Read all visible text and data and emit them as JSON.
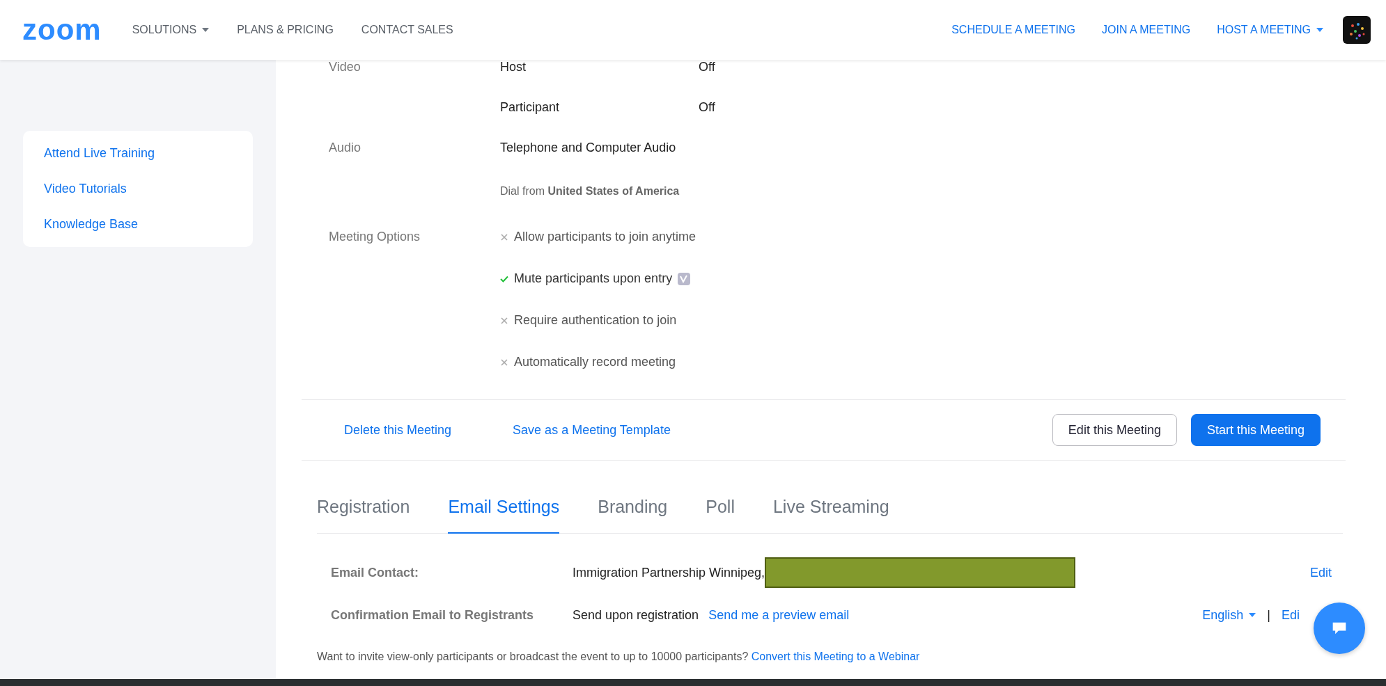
{
  "header": {
    "logo": "zoom",
    "nav_left": [
      {
        "label": "SOLUTIONS",
        "dropdown": true
      },
      {
        "label": "PLANS & PRICING",
        "dropdown": false
      },
      {
        "label": "CONTACT SALES",
        "dropdown": false
      }
    ],
    "nav_right": [
      {
        "label": "SCHEDULE A MEETING",
        "dropdown": false
      },
      {
        "label": "JOIN A MEETING",
        "dropdown": false
      },
      {
        "label": "HOST A MEETING",
        "dropdown": true
      }
    ]
  },
  "sidebar": {
    "links": [
      "Attend Live Training",
      "Video Tutorials",
      "Knowledge Base"
    ]
  },
  "details": {
    "video": {
      "label": "Video",
      "rows": [
        {
          "name": "Host",
          "value": "Off"
        },
        {
          "name": "Participant",
          "value": "Off"
        }
      ]
    },
    "audio": {
      "label": "Audio",
      "value": "Telephone and Computer Audio",
      "dial": "Dial from **United States of America**"
    },
    "meeting_options": {
      "label": "Meeting Options",
      "options": [
        {
          "text": "Allow participants to join anytime",
          "checked": false,
          "info_badge": false
        },
        {
          "text": "Mute participants upon entry",
          "checked": true,
          "info_badge": true
        },
        {
          "text": "Require authentication to join",
          "checked": false,
          "info_badge": false
        },
        {
          "text": "Automatically record meeting",
          "checked": false,
          "info_badge": false
        }
      ]
    }
  },
  "actions": {
    "links": [
      "Delete this Meeting",
      "Save as a Meeting Template"
    ],
    "buttons": [
      {
        "label": "Edit this Meeting",
        "kind": "secondary"
      },
      {
        "label": "Start this Meeting",
        "kind": "primary"
      }
    ]
  },
  "tabs": [
    {
      "label": "Registration",
      "selected": false
    },
    {
      "label": "Email Settings",
      "selected": true
    },
    {
      "label": "Branding",
      "selected": false
    },
    {
      "label": "Poll",
      "selected": false
    },
    {
      "label": "Live Streaming",
      "selected": false
    }
  ],
  "email_settings": [
    {
      "label": "Email Contact:",
      "value": "Immigration Partnership Winnipeg,",
      "redacted": true,
      "edit": "Edit"
    },
    {
      "label": "Confirmation Email to Registrants",
      "value": "Send upon registration",
      "link": "Send me a preview email",
      "language": "English",
      "separator": "|",
      "edit": "Edi"
    }
  ],
  "footer": {
    "text": "Want to invite view-only participants or broadcast the event to up to 10000 participants?",
    "link": "Convert this Meeting to a Webinar"
  }
}
